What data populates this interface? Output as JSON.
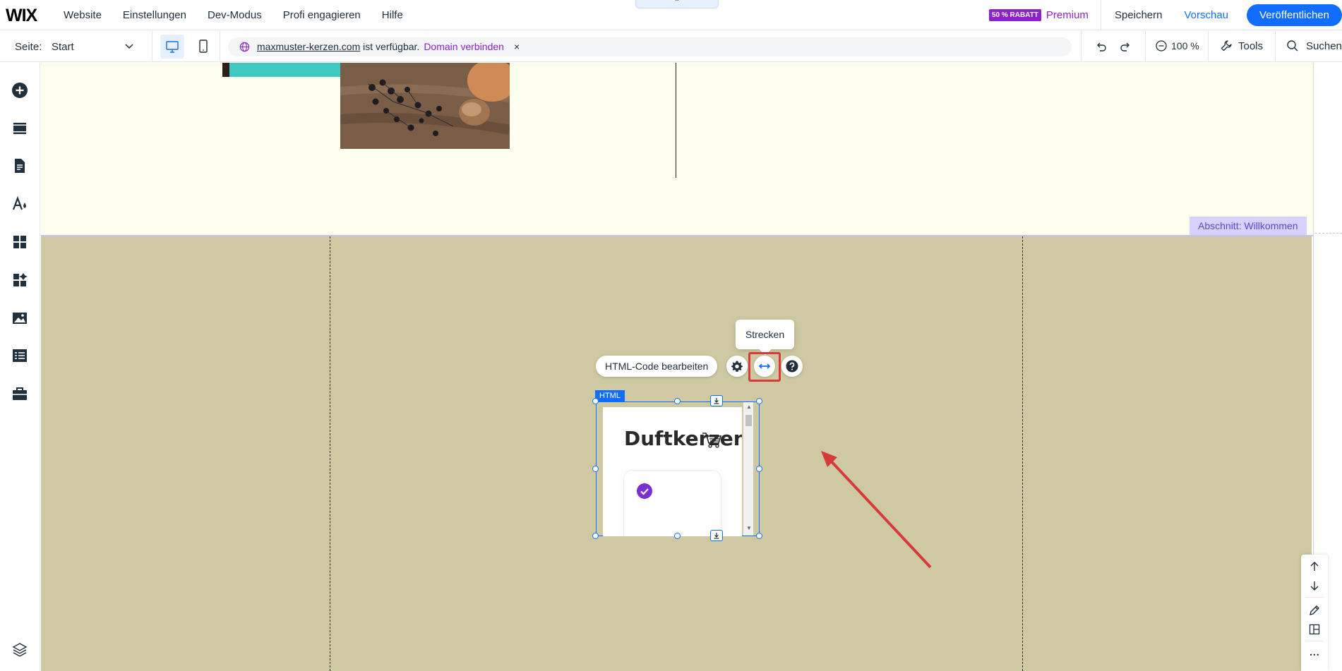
{
  "topbar": {
    "logo": "WIX",
    "menu": [
      "Website",
      "Einstellungen",
      "Dev-Modus",
      "Profi engagieren",
      "Hilfe"
    ],
    "collapse_glyph": "⌃",
    "discount_badge": "50 % RABATT",
    "premium": "Premium",
    "save": "Speichern",
    "preview": "Vorschau",
    "publish": "Veröffentlichen"
  },
  "secondbar": {
    "page_label": "Seite:",
    "page_value": "Start",
    "domain_name": "maxmuster-kerzen.com",
    "domain_status": "ist verfügbar.",
    "domain_connect": "Domain verbinden",
    "domain_close": "×",
    "zoom": "100 %",
    "tools": "Tools",
    "search": "Suchen"
  },
  "canvas": {
    "section_label": "Abschnitt: Willkommen",
    "tooltip": "Strecken",
    "edit_html_button": "HTML-Code bearbeiten",
    "html_tag": "HTML",
    "html_title": "Duftkerzen"
  },
  "colors": {
    "accent_blue": "#116dff",
    "premium_purple": "#8e21c9",
    "section_bg": "#cec9a2",
    "highlight_red": "#d63a3a"
  },
  "icons": {
    "sidebar": [
      "add-icon",
      "sections-icon",
      "pages-icon",
      "design-icon",
      "apps-icon",
      "business-apps-icon",
      "media-icon",
      "cms-icon",
      "portfolio-icon",
      "layers-icon"
    ],
    "right_tools": [
      "move-up-icon",
      "move-down-icon",
      "edit-icon",
      "layout-icon",
      "more-icon"
    ]
  },
  "right_tools": {
    "more": "..."
  }
}
